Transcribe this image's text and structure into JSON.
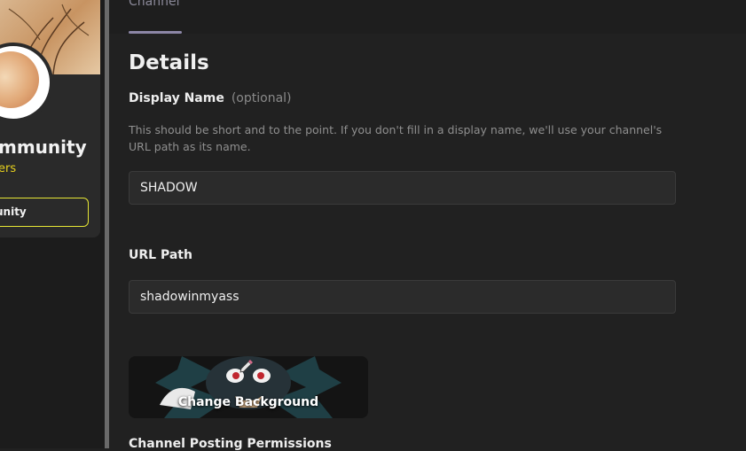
{
  "sidebar": {
    "community_name": "mmunity",
    "community_sub": "ers",
    "community_button": "unity"
  },
  "tabs": {
    "active": "Channel"
  },
  "details": {
    "title": "Details",
    "display_name": {
      "label": "Display Name",
      "optional": "(optional)",
      "help": "This should be short and to the point. If you don't fill in a display name, we'll use your channel's URL path as its name.",
      "value": "SHADOW"
    },
    "url_path": {
      "label": "URL Path",
      "value": "shadowinmyass"
    },
    "background_button": "Change Background",
    "posting_permissions_title": "Channel Posting Permissions"
  },
  "colors": {
    "background": "#212121",
    "accent_yellow": "#e6e635",
    "tab_underline": "#8c86a6"
  }
}
